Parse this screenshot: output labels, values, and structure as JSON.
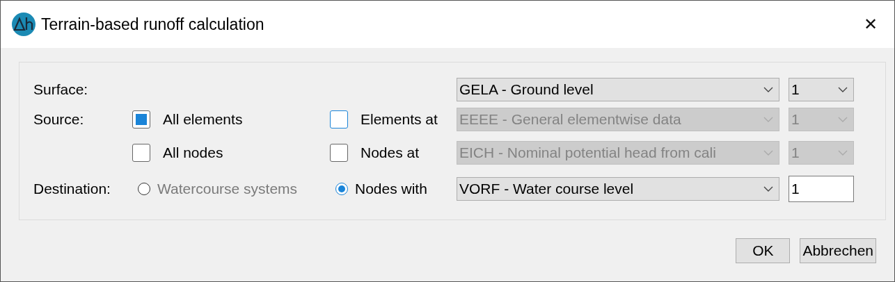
{
  "window": {
    "title": "Terrain-based runoff calculation",
    "close": "✕"
  },
  "surface": {
    "label": "Surface:",
    "combo": {
      "value": "GELA - Ground level",
      "disabled": false
    },
    "index": {
      "value": "1",
      "disabled": false
    }
  },
  "source": {
    "label": "Source:",
    "rows": [
      {
        "left": {
          "label": "All elements",
          "checked": true,
          "focused": false
        },
        "right": {
          "label": "Elements at",
          "checked": false,
          "focused": true
        },
        "combo": {
          "value": "EEEE - General elementwise data",
          "disabled": true
        },
        "index": {
          "value": "1",
          "disabled": true
        }
      },
      {
        "left": {
          "label": "All nodes",
          "checked": false,
          "focused": false
        },
        "right": {
          "label": "Nodes at",
          "checked": false,
          "focused": false
        },
        "combo": {
          "value": "EICH - Nominal potential head from cali",
          "disabled": true
        },
        "index": {
          "value": "1",
          "disabled": true
        }
      }
    ]
  },
  "destination": {
    "label": "Destination:",
    "options": [
      {
        "label": "Watercourse systems",
        "selected": false,
        "disabled": true
      },
      {
        "label": "Nodes with",
        "selected": true,
        "disabled": false
      }
    ],
    "combo": {
      "value": "VORF - Water course level",
      "disabled": false
    },
    "input": {
      "value": "1"
    }
  },
  "buttons": [
    "OK",
    "Abbrechen"
  ]
}
